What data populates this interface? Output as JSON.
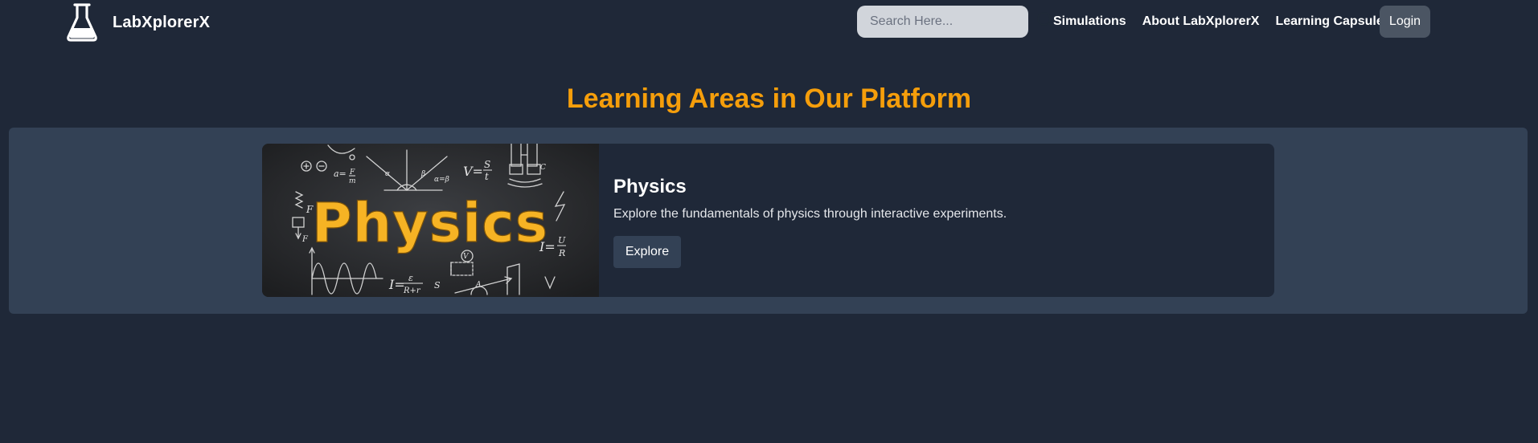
{
  "header": {
    "brand": "LabXplorerX",
    "search": {
      "placeholder": "Search Here...",
      "value": ""
    },
    "nav": [
      {
        "label": "Simulations"
      },
      {
        "label": "About LabXplorerX"
      },
      {
        "label": "Learning Capsules"
      }
    ],
    "login_label": "Login"
  },
  "main": {
    "title": "Learning Areas in Our Platform",
    "cards": [
      {
        "title": "Physics",
        "description": "Explore the fundamentals of physics through interactive experiments.",
        "button_label": "Explore",
        "image_text": "Physics"
      }
    ]
  },
  "colors": {
    "background": "#1f2838",
    "panel": "#334155",
    "accent": "#f59e0b",
    "search_bg": "#d1d5db",
    "login_bg": "#4b5563"
  },
  "icons": {
    "brand": "flask-icon",
    "search": "search-icon"
  }
}
